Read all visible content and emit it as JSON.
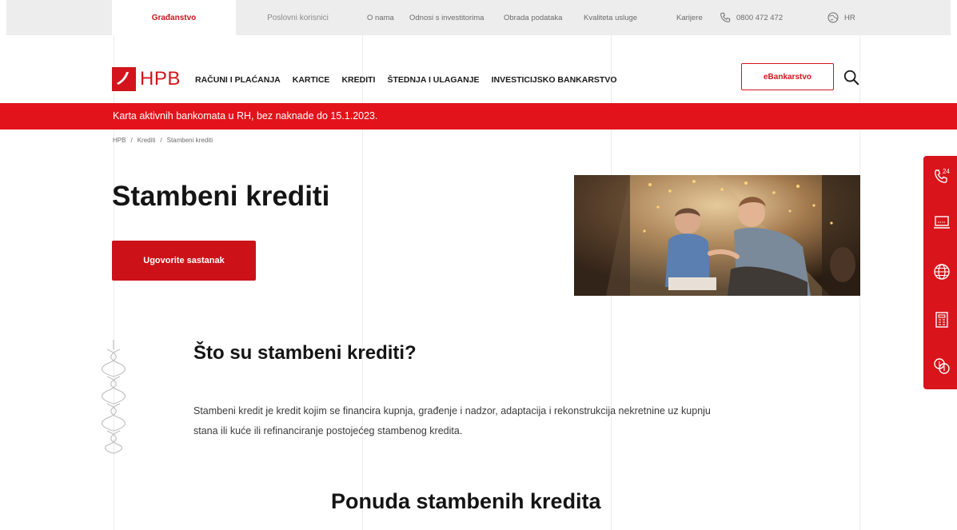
{
  "topbar": {
    "segment_active": "Građanstvo",
    "segment_business": "Poslovni korisnici",
    "links": [
      "O nama",
      "Odnosi s investitorima",
      "Obrada podataka",
      "Kvaliteta usluge",
      "Karijere"
    ],
    "phone": "0800 472 472",
    "language": "HR",
    "icons": [
      "phone-icon",
      "globe-icon"
    ]
  },
  "header": {
    "logo_text": "HPB",
    "nav": [
      "RAČUNI I PLAĆANJA",
      "KARTICE",
      "KREDITI",
      "ŠTEDNJA I ULAGANJE",
      "INVESTICIJSKO BANKARSTVO"
    ],
    "ebank_label": "eBankarstvo"
  },
  "banner": {
    "text": "Karta aktivnih bankomata u RH, bez naknade do 15.1.2023."
  },
  "breadcrumb": [
    "HPB",
    "Krediti",
    "Stambeni krediti"
  ],
  "page": {
    "title": "Stambeni krediti",
    "cta_label": "Ugovorite sastanak"
  },
  "section": {
    "title": "Što su stambeni krediti?",
    "text": "Stambeni kredit je kredit kojim se financira kupnja, građenje i nadzor, adaptacija i rekonstrukcija nekretnine uz kupnju stana ili kuće ili refinanciranje postojećeg stambenog kredita."
  },
  "offer": {
    "title": "Ponuda stambenih kredita"
  },
  "rail": {
    "badge": "24",
    "icons": [
      "phone-24-icon",
      "laptop-icon",
      "globe-icon",
      "calculator-icon",
      "money-icon"
    ]
  },
  "colors": {
    "brand_red": "#d3141c",
    "banner_red": "#e3131b",
    "topbar_bg": "#ededed"
  }
}
